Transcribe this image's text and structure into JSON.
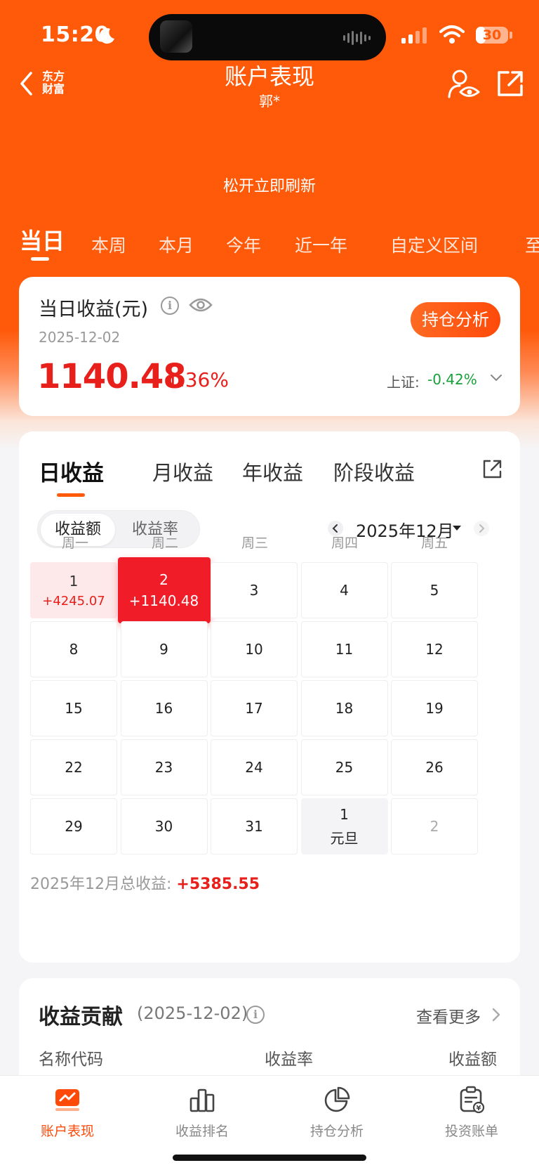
{
  "status_bar": {
    "time": "15:20",
    "battery": "30",
    "battery_level": 0.3
  },
  "nav": {
    "brand": "东方\n财富",
    "title": "账户表现",
    "subtitle": "郭*"
  },
  "refresh_hint": "松开立即刷新",
  "period_tabs": [
    "当日",
    "本周",
    "本月",
    "今年",
    "近一年",
    "自定义区间",
    "至"
  ],
  "daily": {
    "title": "当日收益(元)",
    "date": "2025-12-02",
    "amount": "1140.48",
    "rate": "1.36%",
    "holding_button": "持仓分析",
    "index_label": "上证:",
    "index_value": "-0.42%",
    "colors": {
      "gain": "#e8201c",
      "loss": "#18a03a",
      "accent": "#ff5a0a"
    }
  },
  "calendar": {
    "tabs": [
      "日收益",
      "月收益",
      "年收益",
      "阶段收益"
    ],
    "toggle": [
      "收益额",
      "收益率"
    ],
    "month": "2025年12月",
    "weekdays": [
      "周一",
      "周二",
      "周三",
      "周四",
      "周五"
    ],
    "rows": [
      [
        {
          "day": "1",
          "pnl": "+4245.07",
          "state": "gain"
        },
        {
          "day": "2",
          "pnl": "+1140.48",
          "state": "selected"
        },
        {
          "day": "3"
        },
        {
          "day": "4"
        },
        {
          "day": "5"
        }
      ],
      [
        {
          "day": "8"
        },
        {
          "day": "9"
        },
        {
          "day": "10"
        },
        {
          "day": "11"
        },
        {
          "day": "12"
        }
      ],
      [
        {
          "day": "15"
        },
        {
          "day": "16"
        },
        {
          "day": "17"
        },
        {
          "day": "18"
        },
        {
          "day": "19"
        }
      ],
      [
        {
          "day": "22"
        },
        {
          "day": "23"
        },
        {
          "day": "24"
        },
        {
          "day": "25"
        },
        {
          "day": "26"
        }
      ],
      [
        {
          "day": "29"
        },
        {
          "day": "30"
        },
        {
          "day": "31"
        },
        {
          "day": "1",
          "pnl": "元旦",
          "state": "holiday"
        },
        {
          "day": "2",
          "state": "muted"
        }
      ]
    ],
    "total_label": "2025年12月总收益:",
    "total_value": "+5385.55"
  },
  "contribution": {
    "title": "收益贡献",
    "date": "(2025-12-02)",
    "more": "查看更多",
    "columns": [
      "名称代码",
      "收益率",
      "收益额"
    ]
  },
  "tabbar": [
    {
      "label": "账户表现",
      "icon": "trend-chart-icon",
      "active": true
    },
    {
      "label": "收益排名",
      "icon": "bar-rank-icon",
      "active": false
    },
    {
      "label": "持仓分析",
      "icon": "pie-chart-icon",
      "active": false
    },
    {
      "label": "投资账单",
      "icon": "bill-icon",
      "active": false
    }
  ]
}
